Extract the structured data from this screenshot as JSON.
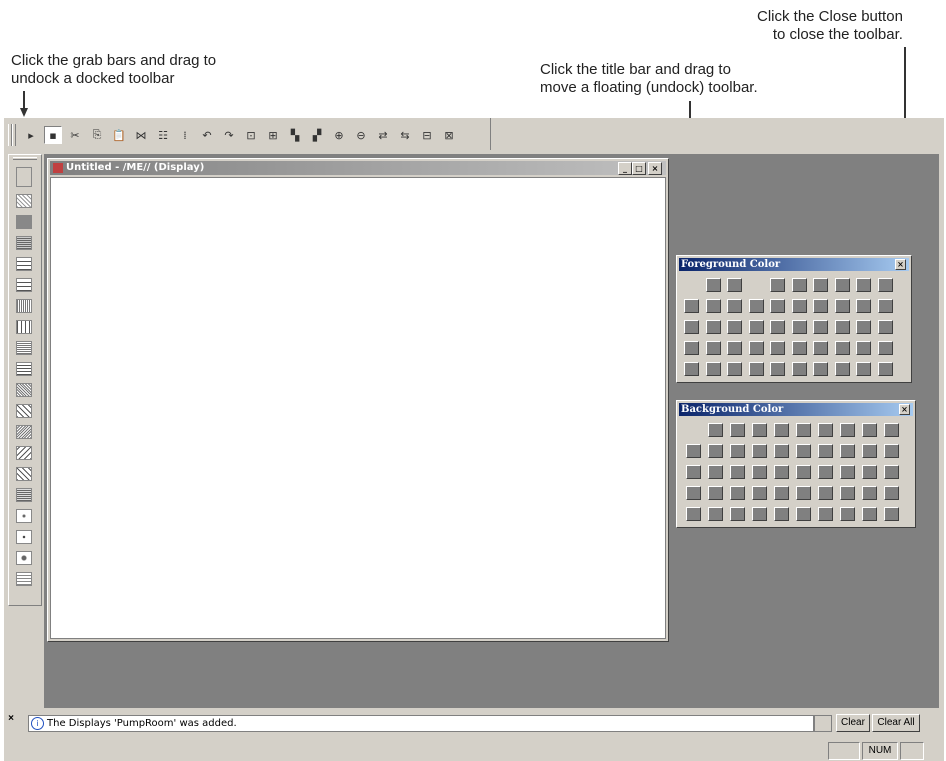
{
  "callouts": {
    "grab": "Click the grab bars and drag to\nundock a docked toolbar",
    "title": "Click the title bar and drag to\nmove a floating (undock) toolbar.",
    "close": "Click the Close button\nto close the toolbar."
  },
  "document": {
    "title": "Untitled - /ME// (Display)",
    "min": "_",
    "max": "□",
    "close": "×"
  },
  "foreground": {
    "title": "Foreground Color",
    "close": "×"
  },
  "background": {
    "title": "Background Color",
    "close": "×"
  },
  "message": {
    "close": "×",
    "text": "The Displays 'PumpRoom' was added.",
    "clear": "Clear",
    "clear_all": "Clear All"
  },
  "status": {
    "num": "NUM"
  },
  "toolbar": {
    "icons": [
      "▸",
      "▪",
      "✂",
      "⎘",
      "📋",
      "⋈",
      "☷",
      "⁞",
      "↶",
      "↷",
      "⊡",
      "⊞",
      "▚",
      "▞",
      "⊕",
      "⊖",
      "⇄",
      "⇆",
      "⊟",
      "⊠"
    ]
  },
  "colors": {
    "swatch": "#808080",
    "workspace": "#808080",
    "frame": "#d4d0c8"
  }
}
